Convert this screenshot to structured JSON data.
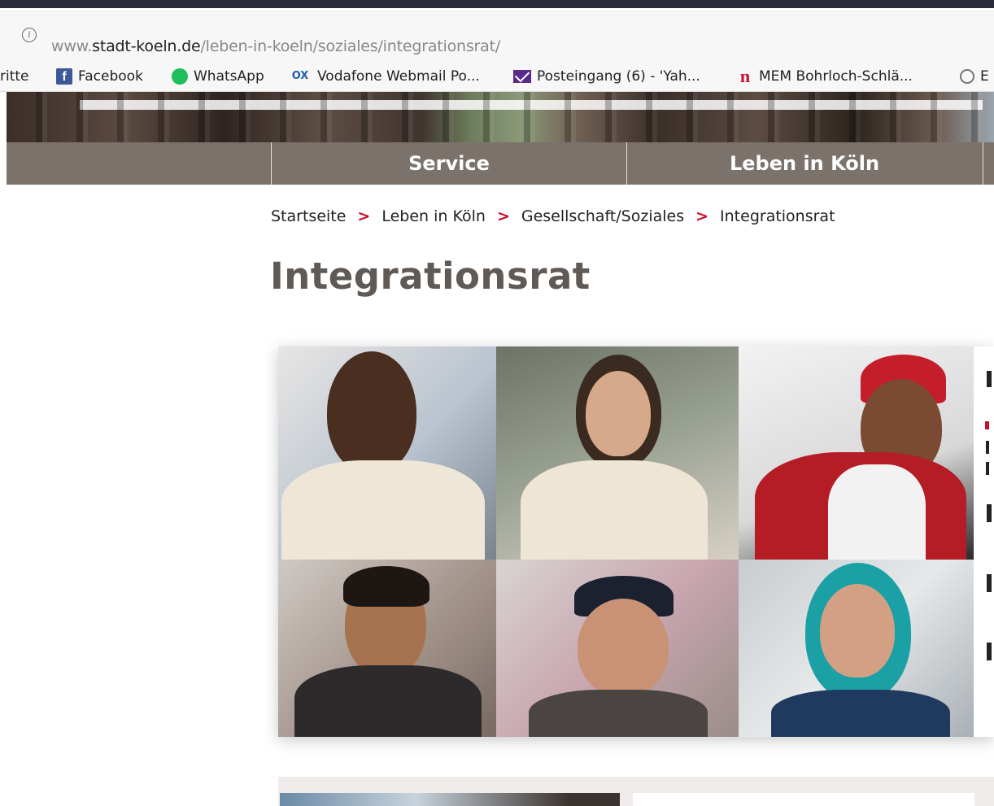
{
  "browser": {
    "url_prefix": "www.",
    "url_domain": "stadt-koeln.de",
    "url_path": "/leben-in-koeln/soziales/integrationsrat/",
    "bookmarks": [
      {
        "label": "ritte",
        "icon": "none"
      },
      {
        "label": "Facebook",
        "icon": "facebook-icon"
      },
      {
        "label": "WhatsApp",
        "icon": "whatsapp-icon"
      },
      {
        "label": "Vodafone Webmail Po...",
        "icon": "ox-icon"
      },
      {
        "label": "Posteingang (6) - 'Yah...",
        "icon": "mail-icon"
      },
      {
        "label": "MEM Bohrloch-Schlä...",
        "icon": "mem-icon"
      },
      {
        "label": "E",
        "icon": "globe-icon"
      }
    ]
  },
  "nav": {
    "items": [
      "Service",
      "Leben in Köln"
    ]
  },
  "breadcrumb": {
    "items": [
      "Startseite",
      "Leben in Köln",
      "Gesellschaft/Soziales",
      "Integrationsrat"
    ],
    "separator": ">"
  },
  "page": {
    "title": "Integrationsrat"
  },
  "colors": {
    "nav_bg": "#7c726c",
    "title": "#605a56",
    "accent": "#c8102e"
  }
}
